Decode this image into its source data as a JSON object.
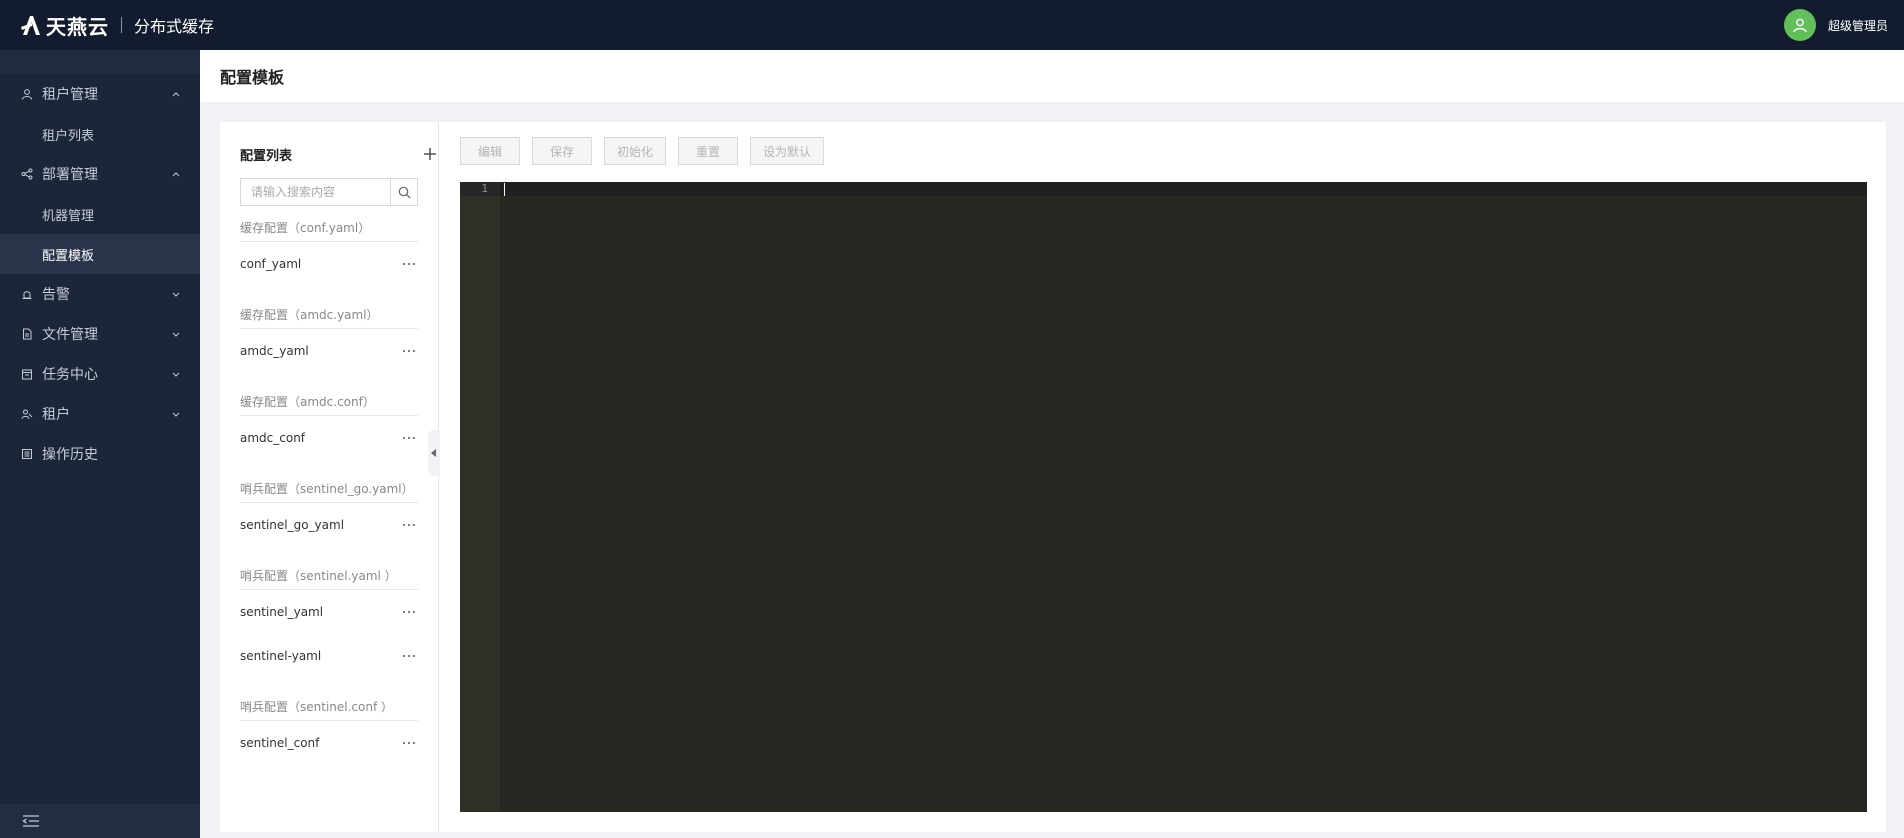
{
  "header": {
    "brand": "天燕云",
    "product": "分布式缓存",
    "user": "超级管理员"
  },
  "sidebar": {
    "items": [
      {
        "label": "租户管理",
        "icon": "user-icon",
        "expanded": true,
        "children": [
          "租户列表"
        ]
      },
      {
        "label": "部署管理",
        "icon": "share-icon",
        "expanded": true,
        "children": [
          "机器管理",
          "配置模板"
        ]
      },
      {
        "label": "告警",
        "icon": "alarm-icon",
        "expanded": false
      },
      {
        "label": "文件管理",
        "icon": "file-icon",
        "expanded": false
      },
      {
        "label": "任务中心",
        "icon": "calendar-icon",
        "expanded": false
      },
      {
        "label": "租户",
        "icon": "users-icon",
        "expanded": false
      },
      {
        "label": "操作历史",
        "icon": "history-icon",
        "expanded": false
      }
    ],
    "active": "配置模板"
  },
  "page": {
    "title": "配置模板"
  },
  "config_list": {
    "title": "配置列表",
    "search_placeholder": "请输入搜索内容",
    "groups": [
      {
        "title": "缓存配置（conf.yaml）",
        "items": [
          "conf_yaml"
        ]
      },
      {
        "title": "缓存配置（amdc.yaml）",
        "items": [
          "amdc_yaml"
        ]
      },
      {
        "title": "缓存配置（amdc.conf）",
        "items": [
          "amdc_conf"
        ]
      },
      {
        "title": "哨兵配置（sentinel_go.yaml）",
        "items": [
          "sentinel_go_yaml"
        ]
      },
      {
        "title": "哨兵配置（sentinel.yaml ）",
        "items": [
          "sentinel_yaml",
          "sentinel-yaml"
        ]
      },
      {
        "title": "哨兵配置（sentinel.conf ）",
        "items": [
          "sentinel_conf"
        ]
      }
    ]
  },
  "toolbar": {
    "buttons": [
      "编辑",
      "保存",
      "初始化",
      "重置",
      "设为默认"
    ]
  },
  "editor": {
    "line_numbers": [
      "1"
    ],
    "content": ""
  },
  "colors": {
    "topbar": "#131c2e",
    "sidebar": "#1c2639",
    "editor_bg": "#272822",
    "avatar": "#62c05a"
  }
}
